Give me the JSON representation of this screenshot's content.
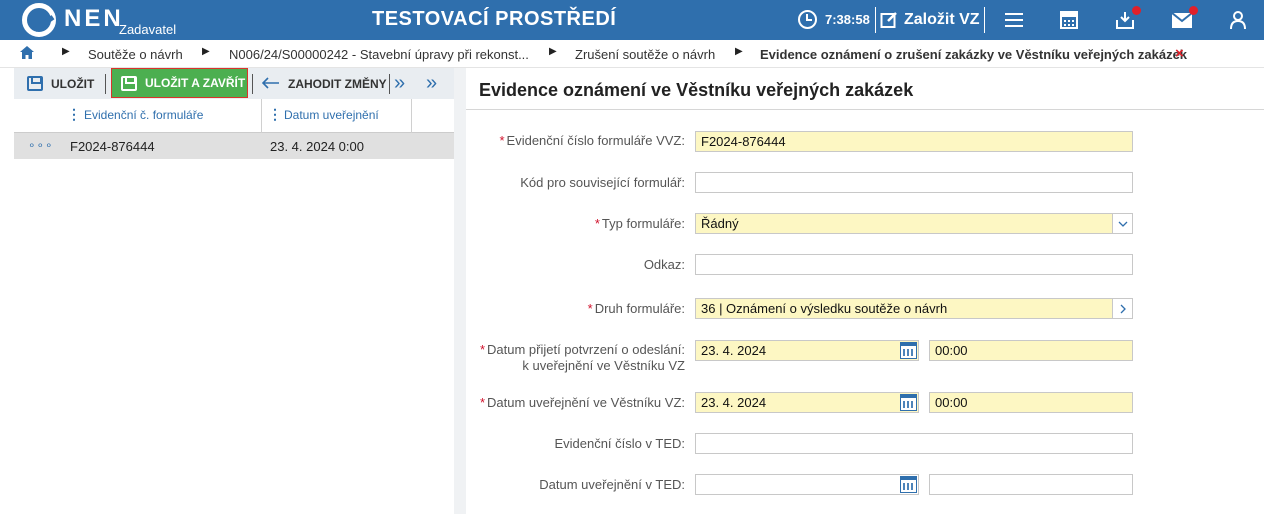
{
  "app": {
    "logo_text": "NEN",
    "logo_sub": "Zadavatel",
    "environment_title": "TESTOVACÍ PROSTŘEDÍ",
    "clock_time": "7:38:58",
    "create_button_label": "Založit VZ",
    "accent_color": "#2f6fad",
    "notification_dot_color": "#e0202a"
  },
  "breadcrumb": {
    "items": [
      "Soutěže o návrh",
      "N006/24/S00000242 - Stavební úpravy při rekonst...",
      "Zrušení soutěže o návrh",
      "Evidence oznámení o zrušení zakázky ve Věstníku veřejných zakázek"
    ],
    "close_symbol": "×"
  },
  "toolbar": {
    "save_label": "ULOŽIT",
    "save_close_label": "ULOŽIT A ZAVŘÍT",
    "discard_label": "ZAHODIT ZMĚNY",
    "more_symbol": "»",
    "collapse_symbol": "»"
  },
  "grid": {
    "columns": [
      "Evidenční č. formuláře",
      "Datum uveřejnění"
    ],
    "rows": [
      {
        "menu": "∘∘∘",
        "form_number": "F2024-876444",
        "published": "23. 4. 2024 0:00"
      }
    ]
  },
  "form": {
    "title": "Evidence oznámení ve Věstníku veřejných zakázek",
    "fields": {
      "form_number": {
        "label": "Evidenční číslo formuláře VVZ:",
        "value": "F2024-876444",
        "required": true
      },
      "related_code": {
        "label": "Kód pro související formulář:",
        "value": "",
        "required": false
      },
      "form_type": {
        "label": "Typ formuláře:",
        "value": "Řádný",
        "required": true
      },
      "link": {
        "label": "Odkaz:",
        "value": "",
        "required": false
      },
      "form_kind": {
        "label": "Druh formuláře:",
        "value": "36 | Oznámení o výsledku soutěže o návrh",
        "required": true
      },
      "receipt_date": {
        "label_line1": "Datum přijetí potvrzení o odeslání:",
        "label_line2": "k uveřejnění ve Věstníku VZ",
        "date": "23. 4. 2024",
        "time": "00:00",
        "required": true
      },
      "published_date": {
        "label": "Datum uveřejnění ve Věstníku VZ:",
        "date": "23. 4. 2024",
        "time": "00:00",
        "required": true
      },
      "ted_number": {
        "label": "Evidenční číslo v TED:",
        "value": "",
        "required": false
      },
      "ted_date": {
        "label": "Datum uveřejnění v TED:",
        "date": "",
        "time": "",
        "required": false
      }
    },
    "required_marker": "*"
  },
  "icons": [
    "logo-icon",
    "clock-icon",
    "edit-icon",
    "hamburger-menu-icon",
    "calculator-icon",
    "inbox-icon",
    "mail-icon",
    "user-icon",
    "home-icon",
    "save-icon",
    "undo-icon",
    "chevron-down-icon",
    "chevron-right-icon",
    "calendar-icon"
  ]
}
